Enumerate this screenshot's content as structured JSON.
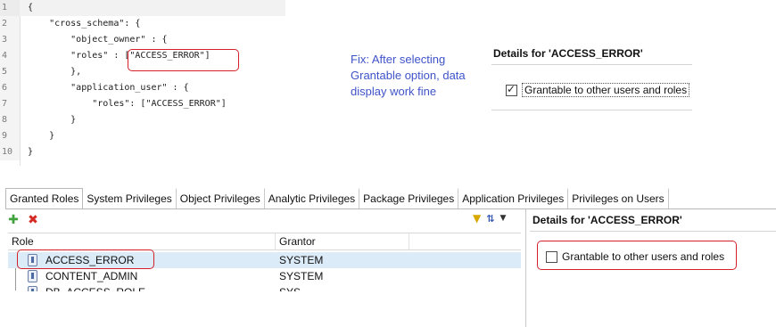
{
  "editor": {
    "lines": [
      {
        "num": "1",
        "code": "{"
      },
      {
        "num": "2",
        "code": "    \"cross_schema\": {"
      },
      {
        "num": "3",
        "code": "        \"object_owner\" : {"
      },
      {
        "num": "4",
        "code": "        \"roles\" : [\"ACCESS_ERROR\"]"
      },
      {
        "num": "5",
        "code": "        },"
      },
      {
        "num": "6",
        "code": "        \"application_user\" : {"
      },
      {
        "num": "7",
        "code": "            \"roles\": [\"ACCESS_ERROR\"]"
      },
      {
        "num": "8",
        "code": "        }"
      },
      {
        "num": "9",
        "code": "    }"
      },
      {
        "num": "10",
        "code": "}"
      }
    ]
  },
  "annotation": {
    "fix_text": "Fix: After selecting Grantable option, data display work fine"
  },
  "top_details": {
    "title": "Details for 'ACCESS_ERROR'",
    "checkbox_label": "Grantable to other users and roles",
    "checked": true
  },
  "tabs": [
    {
      "label": "Granted Roles",
      "active": true
    },
    {
      "label": "System Privileges"
    },
    {
      "label": "Object Privileges"
    },
    {
      "label": "Analytic Privileges"
    },
    {
      "label": "Package Privileges"
    },
    {
      "label": "Application Privileges"
    },
    {
      "label": "Privileges on Users"
    }
  ],
  "toolbar": {
    "add_icon": "plus-icon",
    "remove_icon": "delete-icon",
    "filter_icon": "filter-icon",
    "sort_icon": "sort-icon"
  },
  "grid": {
    "columns": [
      "Role",
      "Grantor"
    ],
    "rows": [
      {
        "role": "ACCESS_ERROR",
        "grantor": "SYSTEM",
        "selected": true
      },
      {
        "role": "CONTENT_ADMIN",
        "grantor": "SYSTEM"
      },
      {
        "role": "DB_ACCESS_ROLE",
        "grantor": "SYS"
      }
    ]
  },
  "bottom_details": {
    "title": "Details for 'ACCESS_ERROR'",
    "checkbox_label": "Grantable to other users and roles",
    "checked": false
  },
  "colors": {
    "annotation_red": "#d3202a",
    "note_blue": "#3f53c9",
    "selection": "#dcebf8"
  }
}
